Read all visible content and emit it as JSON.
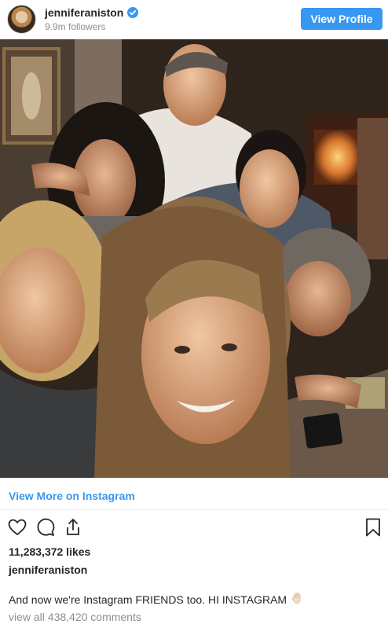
{
  "header": {
    "username": "jenniferaniston",
    "followers": "9.9m followers",
    "view_profile_label": "View Profile",
    "verified_icon": "verified-badge-icon"
  },
  "post": {
    "more_link": "View More on Instagram",
    "likes": "11,283,372 likes",
    "author": "jenniferaniston",
    "caption": "And now we're Instagram FRIENDS too. HI INSTAGRAM",
    "caption_emoji": "waving-hand-icon",
    "comments": "view all 438,420 comments"
  },
  "icons": {
    "like": "heart-icon",
    "comment": "comment-icon",
    "share": "share-icon",
    "save": "bookmark-icon"
  },
  "colors": {
    "accent": "#3897f0",
    "text": "#262626",
    "muted": "#8e8e8e"
  }
}
